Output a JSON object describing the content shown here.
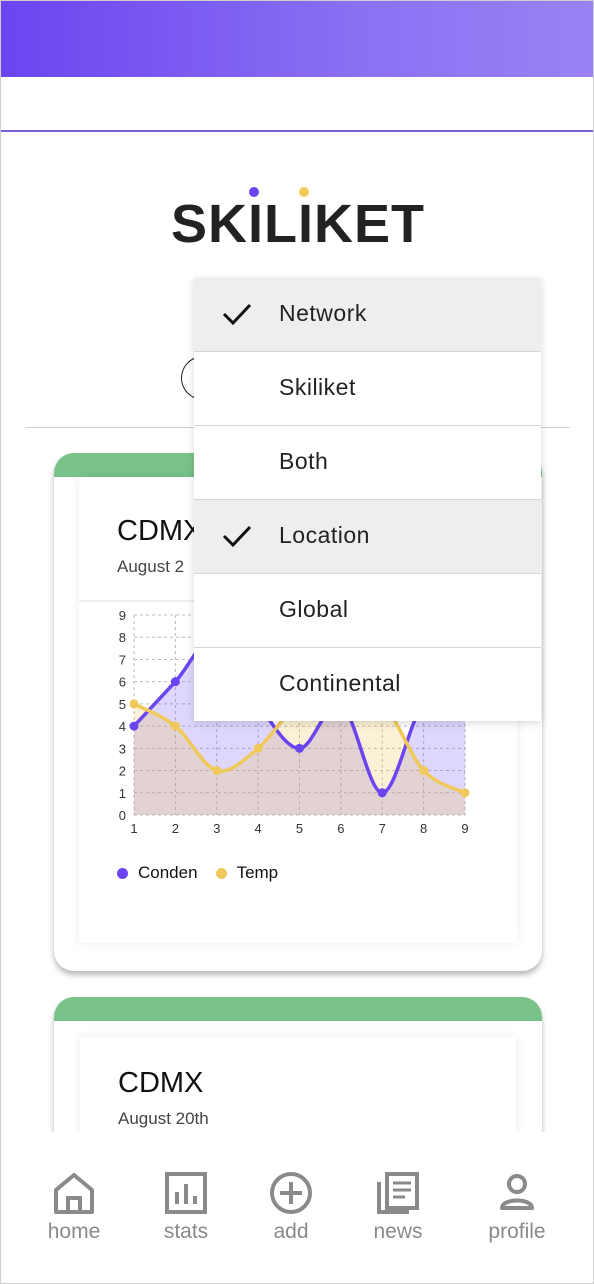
{
  "brand": {
    "name": "SKILIKET",
    "dot1_color": "#6b45f0",
    "dot2_color": "#f0c95a"
  },
  "colors": {
    "accent": "#6b45f0",
    "card_header": "#79c38a",
    "condensation": "#6b45f0",
    "temperature": "#f0c95a"
  },
  "dropdown": {
    "items": [
      {
        "label": "Network",
        "selected": true
      },
      {
        "label": "Skiliket",
        "selected": false
      },
      {
        "label": "Both",
        "selected": false
      },
      {
        "label": "Location",
        "selected": true
      },
      {
        "label": "Global",
        "selected": false
      },
      {
        "label": "Continental",
        "selected": false
      }
    ]
  },
  "cards": [
    {
      "title": "CDMX",
      "date": "August 2"
    },
    {
      "title": "CDMX",
      "date": "August 20th"
    }
  ],
  "chart_data": {
    "type": "line",
    "x": [
      1,
      2,
      3,
      4,
      5,
      6,
      7,
      8,
      9
    ],
    "xlim": [
      1,
      9
    ],
    "ylim": [
      0,
      9
    ],
    "xticks": [
      "1",
      "2",
      "3",
      "4",
      "5",
      "6",
      "7",
      "8",
      "9"
    ],
    "yticks": [
      "0",
      "1",
      "2",
      "3",
      "4",
      "5",
      "6",
      "7",
      "8",
      "9"
    ],
    "grid": true,
    "legend": "bottom-left",
    "series": [
      {
        "name": "Conden",
        "values": [
          4,
          6,
          8,
          5,
          3,
          5,
          1,
          5,
          5
        ]
      },
      {
        "name": "Temp",
        "values": [
          5,
          4,
          2,
          3,
          5,
          5,
          5,
          2,
          1
        ]
      }
    ]
  },
  "nav": {
    "items": [
      {
        "label": "home",
        "icon": "home-icon"
      },
      {
        "label": "stats",
        "icon": "stats-icon"
      },
      {
        "label": "add",
        "icon": "add-icon"
      },
      {
        "label": "news",
        "icon": "news-icon"
      },
      {
        "label": "profile",
        "icon": "profile-icon"
      }
    ]
  }
}
